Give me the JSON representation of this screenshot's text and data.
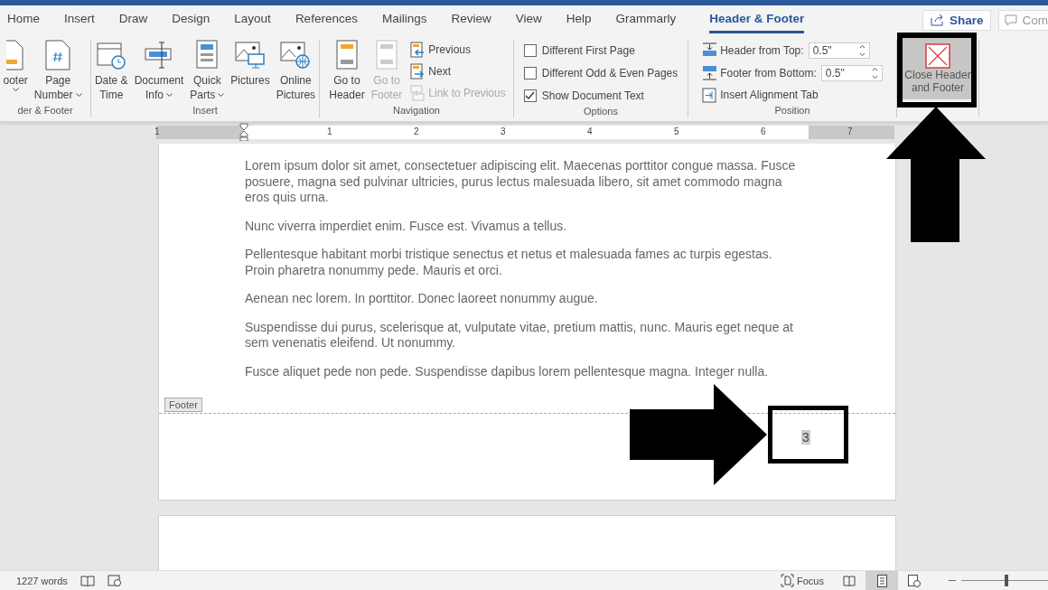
{
  "tabs": [
    {
      "label": "Home",
      "selected": false
    },
    {
      "label": "Insert",
      "selected": false
    },
    {
      "label": "Draw",
      "selected": false
    },
    {
      "label": "Design",
      "selected": false
    },
    {
      "label": "Layout",
      "selected": false
    },
    {
      "label": "References",
      "selected": false
    },
    {
      "label": "Mailings",
      "selected": false
    },
    {
      "label": "Review",
      "selected": false
    },
    {
      "label": "View",
      "selected": false
    },
    {
      "label": "Help",
      "selected": false
    },
    {
      "label": "Grammarly",
      "selected": false
    },
    {
      "label": "Header & Footer",
      "selected": true
    }
  ],
  "share": "Share",
  "comments": "Com",
  "header_footer_group": {
    "label": "der & Footer",
    "buttons": [
      {
        "kind": "footer",
        "lines": [
          "ooter"
        ],
        "dropdown": true
      },
      {
        "kind": "page-number",
        "lines": [
          "Page",
          "Number"
        ],
        "dropdown": true
      }
    ]
  },
  "insert_group": {
    "label": "Insert",
    "buttons": [
      {
        "kind": "date-time",
        "lines": [
          "Date &",
          "Time"
        ],
        "dropdown": false
      },
      {
        "kind": "document-info",
        "lines": [
          "Document",
          "Info"
        ],
        "dropdown": true
      },
      {
        "kind": "quick-parts",
        "lines": [
          "Quick",
          "Parts"
        ],
        "dropdown": true
      },
      {
        "kind": "pictures",
        "lines": [
          "Pictures"
        ],
        "dropdown": false
      },
      {
        "kind": "online-pictures",
        "lines": [
          "Online",
          "Pictures"
        ],
        "dropdown": false
      }
    ]
  },
  "navigation_group": {
    "label": "Navigation",
    "large": [
      {
        "lines": [
          "Go to",
          "Header"
        ],
        "disabled": false
      },
      {
        "lines": [
          "Go to",
          "Footer"
        ],
        "disabled": true
      }
    ],
    "small": [
      {
        "kind": "previous",
        "label": "Previous",
        "disabled": false
      },
      {
        "kind": "next",
        "label": "Next",
        "disabled": false
      },
      {
        "kind": "link",
        "label": "Link to Previous",
        "disabled": true
      }
    ]
  },
  "options_group": {
    "label": "Options",
    "checkboxes": [
      {
        "label": "Different First Page",
        "checked": false
      },
      {
        "label": "Different Odd & Even Pages",
        "checked": false
      },
      {
        "label": "Show Document Text",
        "checked": true
      }
    ]
  },
  "position_group": {
    "label": "Position",
    "rows": [
      {
        "kind": "spin",
        "label": "Header from Top:",
        "value": "0.5\""
      },
      {
        "kind": "spin",
        "label": "Footer from Bottom:",
        "value": "0.5\""
      },
      {
        "kind": "button",
        "label": "Insert Alignment Tab"
      }
    ]
  },
  "close_group": {
    "button": {
      "lines": [
        "Close Header",
        "and Footer"
      ],
      "highlighted": true
    }
  },
  "ruler": [
    "1",
    "1",
    "2",
    "3",
    "4",
    "5",
    "6",
    "7"
  ],
  "page": {
    "paragraphs": [
      "Lorem ipsum dolor sit amet, consectetuer adipiscing elit. Maecenas porttitor congue massa. Fusce posuere, magna sed pulvinar ultricies, purus lectus malesuada libero, sit amet commodo magna eros quis urna.",
      "Nunc viverra imperdiet enim. Fusce est. Vivamus a tellus.",
      "Pellentesque habitant morbi tristique senectus et netus et malesuada fames ac turpis egestas. Proin pharetra nonummy pede. Mauris et orci.",
      "Aenean nec lorem. In porttitor. Donec laoreet nonummy augue.",
      "Suspendisse dui purus, scelerisque at, vulputate vitae, pretium mattis, nunc. Mauris eget neque at sem venenatis eleifend. Ut nonummy.",
      "Fusce aliquet pede non pede. Suspendisse dapibus lorem pellentesque magna. Integer nulla."
    ],
    "footer_tag": "Footer",
    "page_number": "3"
  },
  "status_bar": {
    "words": "1227 words",
    "focus": "Focus",
    "views": [
      {
        "kind": "read",
        "selected": false
      },
      {
        "kind": "print",
        "selected": true
      },
      {
        "kind": "web",
        "selected": false
      }
    ],
    "zoom": {
      "level": 0.5
    }
  }
}
